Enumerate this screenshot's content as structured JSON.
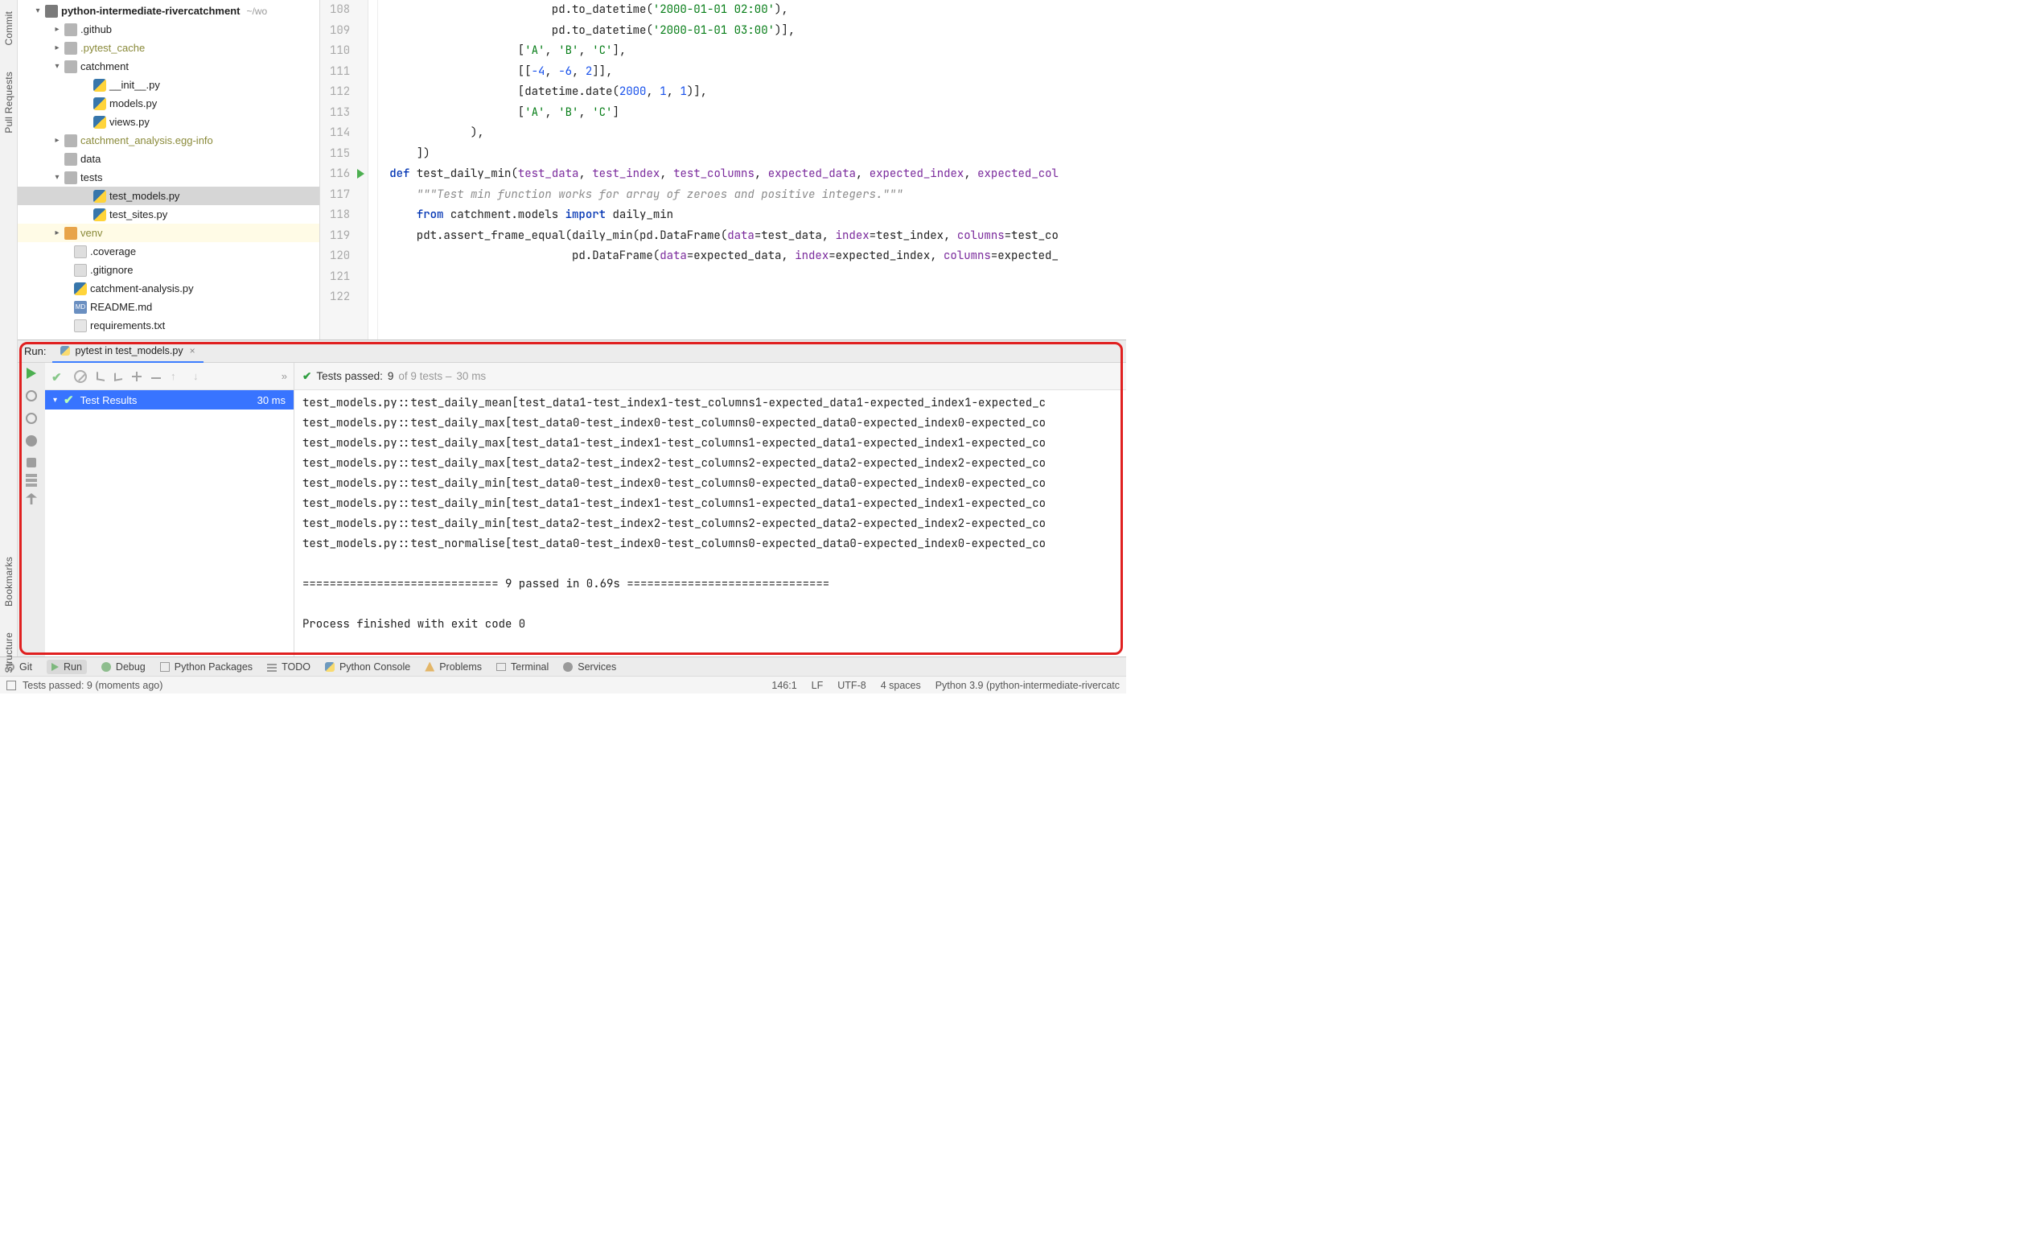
{
  "left_gutter": {
    "tabs": [
      "Commit",
      "Pull Requests",
      "Bookmarks",
      "Structure"
    ]
  },
  "project": {
    "name": "python-intermediate-rivercatchment",
    "path_hint": "~/wo",
    "tree": [
      {
        "indent": 20,
        "twisty": "down",
        "icon": "module",
        "label": "python-intermediate-rivercatchment",
        "bold": true,
        "path_hint": "~/wo"
      },
      {
        "indent": 44,
        "twisty": "right",
        "icon": "folder",
        "label": ".github"
      },
      {
        "indent": 44,
        "twisty": "right",
        "icon": "folder",
        "label": ".pytest_cache",
        "dim": true
      },
      {
        "indent": 44,
        "twisty": "down",
        "icon": "folder",
        "label": "catchment"
      },
      {
        "indent": 80,
        "twisty": "blank",
        "icon": "py",
        "label": "__init__.py"
      },
      {
        "indent": 80,
        "twisty": "blank",
        "icon": "py",
        "label": "models.py"
      },
      {
        "indent": 80,
        "twisty": "blank",
        "icon": "py",
        "label": "views.py"
      },
      {
        "indent": 44,
        "twisty": "right",
        "icon": "folder",
        "label": "catchment_analysis.egg-info",
        "dim": true
      },
      {
        "indent": 44,
        "twisty": "blank",
        "icon": "folder",
        "label": "data"
      },
      {
        "indent": 44,
        "twisty": "down",
        "icon": "folder",
        "label": "tests"
      },
      {
        "indent": 80,
        "twisty": "blank",
        "icon": "py",
        "label": "test_models.py",
        "selected": true
      },
      {
        "indent": 80,
        "twisty": "blank",
        "icon": "py",
        "label": "test_sites.py"
      },
      {
        "indent": 44,
        "twisty": "right",
        "icon": "folder-ex",
        "label": "venv",
        "dim": true,
        "excluded": true
      },
      {
        "indent": 56,
        "twisty": "blank",
        "icon": "file",
        "label": ".coverage"
      },
      {
        "indent": 56,
        "twisty": "blank",
        "icon": "file",
        "label": ".gitignore"
      },
      {
        "indent": 56,
        "twisty": "blank",
        "icon": "py",
        "label": "catchment-analysis.py"
      },
      {
        "indent": 56,
        "twisty": "blank",
        "icon": "md",
        "label": "README.md"
      },
      {
        "indent": 56,
        "twisty": "blank",
        "icon": "txt",
        "label": "requirements.txt"
      }
    ]
  },
  "editor": {
    "first_line": 108,
    "run_marker_line": 116,
    "lines": [
      {
        "n": 108,
        "segs": [
          [
            "                        pd.to_datetime(",
            ""
          ],
          [
            "'2000-01-01 02:00'",
            "str"
          ],
          [
            "),",
            ""
          ]
        ]
      },
      {
        "n": 109,
        "segs": [
          [
            "                        pd.to_datetime(",
            ""
          ],
          [
            "'2000-01-01 03:00'",
            "str"
          ],
          [
            ")],",
            ""
          ]
        ]
      },
      {
        "n": 110,
        "segs": [
          [
            "                   [",
            ""
          ],
          [
            "'A'",
            "str"
          ],
          [
            ", ",
            ""
          ],
          [
            "'B'",
            "str"
          ],
          [
            ", ",
            ""
          ],
          [
            "'C'",
            "str"
          ],
          [
            "],",
            ""
          ]
        ]
      },
      {
        "n": 111,
        "segs": [
          [
            "                   [[",
            ""
          ],
          [
            "-4",
            "num"
          ],
          [
            ", ",
            ""
          ],
          [
            "-6",
            "num"
          ],
          [
            ", ",
            ""
          ],
          [
            "2",
            "num"
          ],
          [
            "]],",
            ""
          ]
        ]
      },
      {
        "n": 112,
        "segs": [
          [
            "                   [datetime.date(",
            ""
          ],
          [
            "2000",
            "num"
          ],
          [
            ", ",
            ""
          ],
          [
            "1",
            "num"
          ],
          [
            ", ",
            ""
          ],
          [
            "1",
            "num"
          ],
          [
            ")],",
            ""
          ]
        ]
      },
      {
        "n": 113,
        "segs": [
          [
            "                   [",
            ""
          ],
          [
            "'A'",
            "str"
          ],
          [
            ", ",
            ""
          ],
          [
            "'B'",
            "str"
          ],
          [
            ", ",
            ""
          ],
          [
            "'C'",
            "str"
          ],
          [
            "]",
            ""
          ]
        ]
      },
      {
        "n": 114,
        "segs": [
          [
            "            ),",
            ""
          ]
        ]
      },
      {
        "n": 115,
        "segs": [
          [
            "    ])",
            ""
          ]
        ]
      },
      {
        "n": 116,
        "segs": [
          [
            "def ",
            "kw"
          ],
          [
            "test_daily_min",
            "fn"
          ],
          [
            "(",
            ""
          ],
          [
            "test_data",
            "param"
          ],
          [
            ", ",
            ""
          ],
          [
            "test_index",
            "param"
          ],
          [
            ", ",
            ""
          ],
          [
            "test_columns",
            "param"
          ],
          [
            ", ",
            ""
          ],
          [
            "expected_data",
            "param"
          ],
          [
            ", ",
            ""
          ],
          [
            "expected_index",
            "param"
          ],
          [
            ", ",
            ""
          ],
          [
            "expected_col",
            "param"
          ]
        ]
      },
      {
        "n": 117,
        "segs": [
          [
            "    ",
            ""
          ],
          [
            "\"\"\"Test min function works for array of zeroes and positive integers.\"\"\"",
            "doc"
          ]
        ]
      },
      {
        "n": 118,
        "segs": [
          [
            "    ",
            ""
          ],
          [
            "from ",
            "kw"
          ],
          [
            "catchment.models ",
            ""
          ],
          [
            "import ",
            "kw"
          ],
          [
            "daily_min",
            ""
          ]
        ]
      },
      {
        "n": 119,
        "segs": [
          [
            "    pdt.assert_frame_equal(daily_min(pd.DataFrame(",
            ""
          ],
          [
            "data",
            "param"
          ],
          [
            "=test_data, ",
            ""
          ],
          [
            "index",
            "param"
          ],
          [
            "=test_index, ",
            ""
          ],
          [
            "columns",
            "param"
          ],
          [
            "=test_co",
            ""
          ]
        ]
      },
      {
        "n": 120,
        "segs": [
          [
            "                           pd.DataFrame(",
            ""
          ],
          [
            "data",
            "param"
          ],
          [
            "=expected_data, ",
            ""
          ],
          [
            "index",
            "param"
          ],
          [
            "=expected_index, ",
            ""
          ],
          [
            "columns",
            "param"
          ],
          [
            "=expected_",
            ""
          ]
        ]
      },
      {
        "n": 121,
        "segs": [
          [
            "",
            ""
          ]
        ]
      },
      {
        "n": 122,
        "segs": [
          [
            "",
            ""
          ]
        ]
      }
    ]
  },
  "run": {
    "label": "Run:",
    "tab_title": "pytest in test_models.py",
    "status_prefix": "Tests passed: ",
    "status_passed": "9",
    "status_of": " of 9 tests – ",
    "status_time": "30 ms",
    "tree_root": "Test Results",
    "tree_time": "30 ms",
    "output_lines": [
      "test_models.py::test_daily_mean[test_data1-test_index1-test_columns1-expected_data1-expected_index1-expected_c",
      "test_models.py::test_daily_max[test_data0-test_index0-test_columns0-expected_data0-expected_index0-expected_co",
      "test_models.py::test_daily_max[test_data1-test_index1-test_columns1-expected_data1-expected_index1-expected_co",
      "test_models.py::test_daily_max[test_data2-test_index2-test_columns2-expected_data2-expected_index2-expected_co",
      "test_models.py::test_daily_min[test_data0-test_index0-test_columns0-expected_data0-expected_index0-expected_co",
      "test_models.py::test_daily_min[test_data1-test_index1-test_columns1-expected_data1-expected_index1-expected_co",
      "test_models.py::test_daily_min[test_data2-test_index2-test_columns2-expected_data2-expected_index2-expected_co",
      "test_models.py::test_normalise[test_data0-test_index0-test_columns0-expected_data0-expected_index0-expected_co",
      "",
      "============================= 9 passed in 0.69s ==============================",
      "",
      "Process finished with exit code 0"
    ]
  },
  "bottom_bar": {
    "items": [
      {
        "icon": "git",
        "label": "Git"
      },
      {
        "icon": "run",
        "label": "Run",
        "active": true
      },
      {
        "icon": "bug",
        "label": "Debug"
      },
      {
        "icon": "box",
        "label": "Python Packages"
      },
      {
        "icon": "list",
        "label": "TODO"
      },
      {
        "icon": "py",
        "label": "Python Console"
      },
      {
        "icon": "warn",
        "label": "Problems"
      },
      {
        "icon": "term",
        "label": "Terminal"
      },
      {
        "icon": "gear",
        "label": "Services"
      }
    ]
  },
  "status_bar": {
    "left": "Tests passed: 9 (moments ago)",
    "right": [
      "146:1",
      "LF",
      "UTF-8",
      "4 spaces",
      "Python 3.9 (python-intermediate-rivercatc"
    ]
  }
}
